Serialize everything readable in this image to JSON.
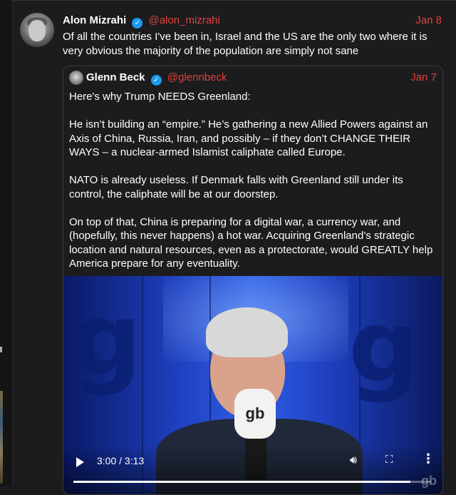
{
  "tweet": {
    "author_name": "Alon Mizrahi",
    "author_handle": "@alon_mizrahi",
    "date": "Jan 8",
    "text": "Of all the countries I've been in, Israel and the US are the only two where it is very obvious the majority of the population are simply not sane"
  },
  "quoted": {
    "author_name": "Glenn Beck",
    "author_handle": "@glennbeck",
    "date": "Jan 7",
    "paragraphs": [
      "Here's why Trump NEEDS Greenland:",
      "He isn’t building an “empire.” He’s gathering a new Allied Powers against an Axis of China, Russia, Iran, and possibly – if they don’t CHANGE THEIR WAYS – a nuclear-armed Islamist caliphate called Europe.",
      "NATO is already useless. If Denmark falls with Greenland still under its control, the caliphate will be at our doorstep.",
      "On top of that, China is preparing for a digital war, a currency war, and (hopefully, this never happens) a hot war. Acquiring Greenland’s strategic location and natural resources, even as a protectorate, would GREATLY help America prepare for any eventuality."
    ]
  },
  "video": {
    "time_display": "3:00 / 3:13",
    "progress_fraction": 0.942,
    "mic_logo": "gb",
    "watermark": "gb"
  },
  "colors": {
    "background": "#1c1c1e",
    "accent": "#e0403a",
    "verified": "#1d9bf0"
  },
  "icons": {
    "verified": "verified-badge-icon",
    "play": "play-icon",
    "volume": "volume-icon",
    "fullscreen": "fullscreen-icon",
    "more": "more-vertical-icon"
  }
}
